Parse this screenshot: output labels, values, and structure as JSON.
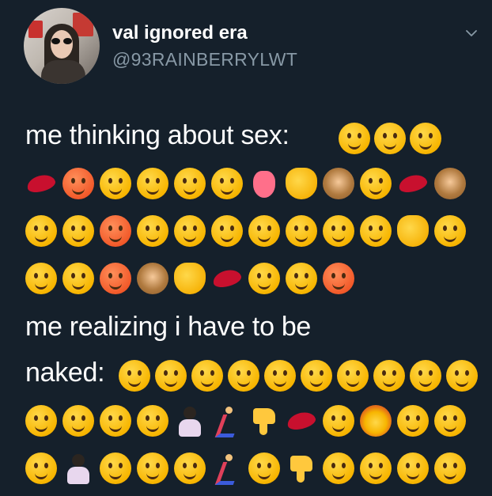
{
  "tweet": {
    "display_name": "val ignored era",
    "handle": "@93RAINBERRYLWT",
    "text_line_1": "me thinking about sex:",
    "text_line_5": "me realizing i have to be",
    "text_line_6": "naked:"
  },
  "icons": {
    "menu": "chevron-down-icon"
  }
}
